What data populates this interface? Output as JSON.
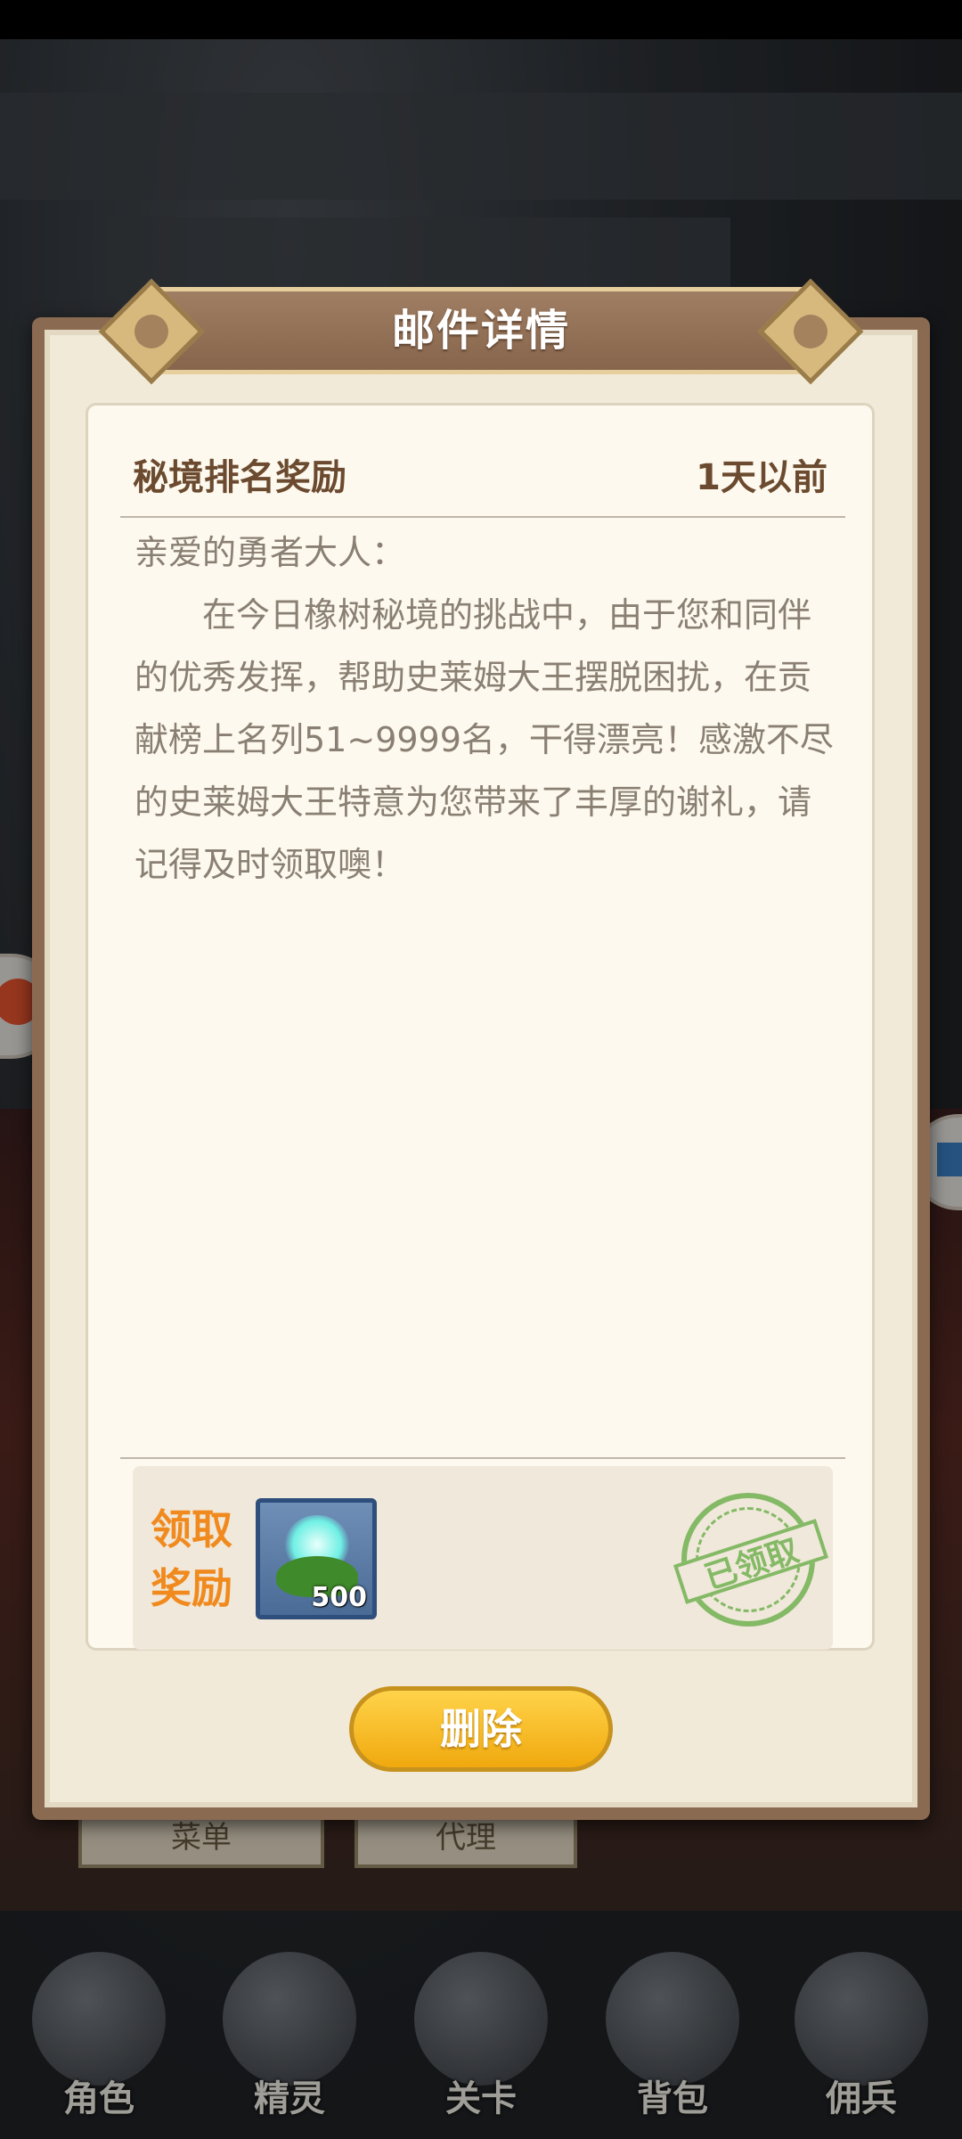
{
  "dialog": {
    "title": "邮件详情",
    "subject": "秘境排名奖励",
    "time": "1天以前",
    "body": {
      "greeting": "亲爱的勇者大人：",
      "paragraph": "在今日橡树秘境的挑战中，由于您和同伴的优秀发挥，帮助史莱姆大王摆脱困扰，在贡献榜上名列51~9999名，干得漂亮！感激不尽的史莱姆大王特意为您带来了丰厚的谢礼，请记得及时领取噢！"
    },
    "reward": {
      "label_line1": "领取",
      "label_line2": "奖励",
      "item_count": "500",
      "item_icon": "spirit-flower-icon",
      "status_stamp": "已领取"
    },
    "delete_button": "删除"
  },
  "background": {
    "tabs": [
      "菜单",
      "代理"
    ]
  },
  "bottom_nav": [
    {
      "label": "角色",
      "icon": "character-icon"
    },
    {
      "label": "精灵",
      "icon": "sprite-icon"
    },
    {
      "label": "关卡",
      "icon": "stage-icon"
    },
    {
      "label": "背包",
      "icon": "backpack-icon"
    },
    {
      "label": "佣兵",
      "icon": "mercenary-icon"
    }
  ],
  "colors": {
    "dialog_frame": "#8a6b52",
    "card_bg": "#fdf9ee",
    "title_text": "#ffffff",
    "reward_label": "#f08a1e",
    "stamp_green": "#79b45a",
    "delete_button": "#f0a90e"
  }
}
